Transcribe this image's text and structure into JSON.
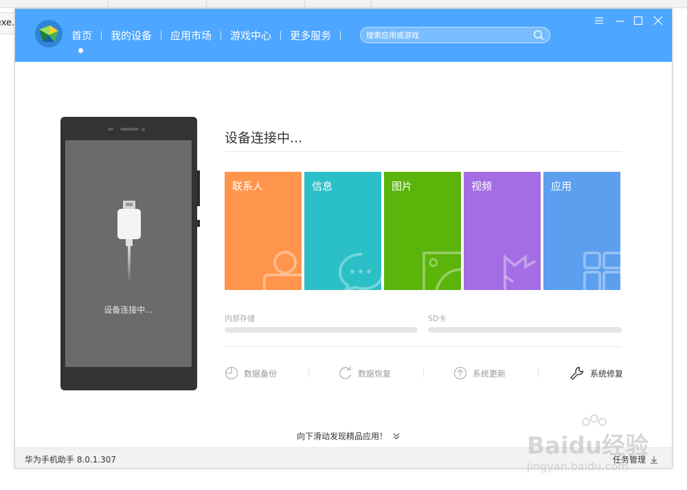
{
  "background_window": {
    "left_text": ".exe"
  },
  "app": {
    "nav": [
      "首页",
      "我的设备",
      "应用市场",
      "游戏中心",
      "更多服务"
    ],
    "search_placeholder": "搜索应用或游戏"
  },
  "phone": {
    "status": "设备连接中..."
  },
  "main": {
    "title": "设备连接中...",
    "tiles": [
      {
        "label": "联系人",
        "color": "#ff954c",
        "icon": "contact-icon"
      },
      {
        "label": "信息",
        "color": "#2bbfc7",
        "icon": "message-icon"
      },
      {
        "label": "图片",
        "color": "#5ab40a",
        "icon": "picture-icon"
      },
      {
        "label": "视频",
        "color": "#a46de3",
        "icon": "video-icon"
      },
      {
        "label": "应用",
        "color": "#5b9fee",
        "icon": "apps-icon"
      }
    ],
    "storage": [
      {
        "label": "内部存储",
        "fill": 0
      },
      {
        "label": "SD卡",
        "fill": 0
      }
    ],
    "actions": [
      {
        "label": "数据备份",
        "icon": "backup-icon"
      },
      {
        "label": "数据恢复",
        "icon": "restore-icon"
      },
      {
        "label": "系统更新",
        "icon": "update-icon"
      },
      {
        "label": "系统修复",
        "icon": "repair-icon"
      }
    ],
    "scroll_hint": "向下滑动发现精品应用！"
  },
  "statusbar": {
    "version": "华为手机助手 8.0.1.307",
    "task_manager": "任务管理"
  },
  "watermark": {
    "line1": "Baidu经验",
    "line2": "jingyan.baidu.com"
  }
}
